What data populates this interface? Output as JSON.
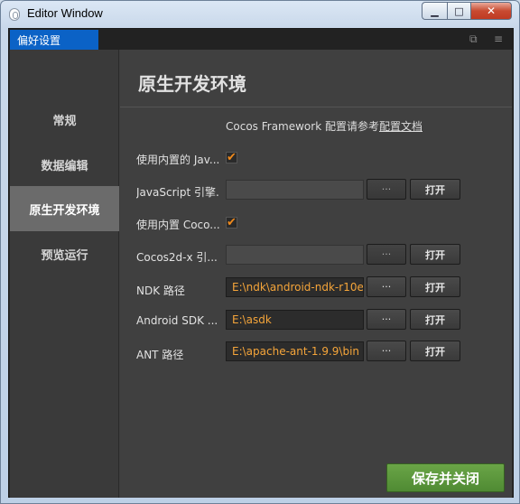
{
  "window": {
    "title": "Editor Window",
    "min_glyph": "▁",
    "max_glyph": "□",
    "close_glyph": "✕"
  },
  "tab": {
    "label": "偏好设置",
    "tool1_glyph": "⧉",
    "tool2_glyph": "≡"
  },
  "sidebar": {
    "items": [
      {
        "label": "常规",
        "active": false
      },
      {
        "label": "数据编辑",
        "active": false
      },
      {
        "label": "原生开发环境",
        "active": true
      },
      {
        "label": "预览运行",
        "active": false
      }
    ]
  },
  "main": {
    "title": "原生开发环境",
    "doc_prefix": "Cocos Framework 配置请参考",
    "doc_link": "配置文档",
    "rows": {
      "use_builtin_js": {
        "label": "使用内置的 Jav...",
        "checked": true,
        "check_glyph": "✔"
      },
      "js_engine": {
        "label": "JavaScript 引擎...",
        "value": "",
        "browse": "···",
        "open": "打开"
      },
      "use_builtin_cocos": {
        "label": "使用内置 Coco...",
        "checked": true,
        "check_glyph": "✔"
      },
      "cocos2dx_engine": {
        "label": "Cocos2d-x 引...",
        "value": "",
        "browse": "···",
        "open": "打开"
      },
      "ndk": {
        "label": "NDK 路径",
        "value": "E:\\ndk\\android-ndk-r10e",
        "browse": "···",
        "open": "打开"
      },
      "android_sdk": {
        "label": "Android SDK ...",
        "value": "E:\\asdk",
        "browse": "···",
        "open": "打开"
      },
      "ant": {
        "label": "ANT 路径",
        "value": "E:\\apache-ant-1.9.9\\bin",
        "browse": "···",
        "open": "打开"
      }
    },
    "save_label": "保存并关闭"
  },
  "colors": {
    "accent_tab": "#0b62c6",
    "checkbox_check": "#f08a1c",
    "path_text": "#f5a53a",
    "save_button": "#5c9a3d"
  }
}
